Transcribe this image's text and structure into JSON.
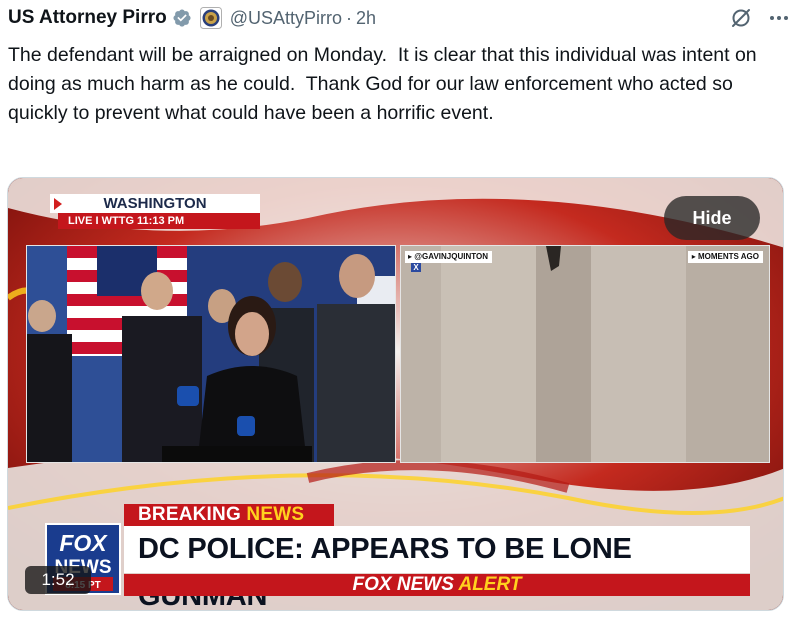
{
  "tweet": {
    "display_name": "US Attorney Pirro",
    "handle": "@USAttyPirro",
    "separator": "·",
    "time": "2h",
    "text": "The defendant will be arraigned on Monday.  It is clear that this individual was intent on doing as much harm as he could.  Thank God for our law enforcement who acted so quickly to prevent what could have been a horrific event."
  },
  "icons": {
    "verified": "verified-badge-icon",
    "seal": "doj-seal-icon",
    "grok": "grok-icon",
    "more": "more-icon"
  },
  "video": {
    "location": "WASHINGTON",
    "live_label": "LIVE  I  WTTG    11:13 PM",
    "left_tag": "▸ @GAVINJQUINTON",
    "left_tag_x": "X",
    "right_tag": "▸ MOMENTS AGO",
    "hide_label": "Hide",
    "breaking_prefix": "BREAKING ",
    "breaking_news": "NEWS",
    "headline": "DC POLICE: APPEARS TO BE LONE GUNMAN",
    "alert_prefix": "FOX NEWS ",
    "alert_word": "ALERT",
    "duration": "1:52",
    "fox_logo_line1": "FOX",
    "fox_logo_line2": "NEWS",
    "fox_logo_line3": "8:15 PT"
  },
  "colors": {
    "red": "#c4161c",
    "yellow": "#ffd21e",
    "navy": "#1a3c8e",
    "verified_blue": "#1d9bf0"
  }
}
